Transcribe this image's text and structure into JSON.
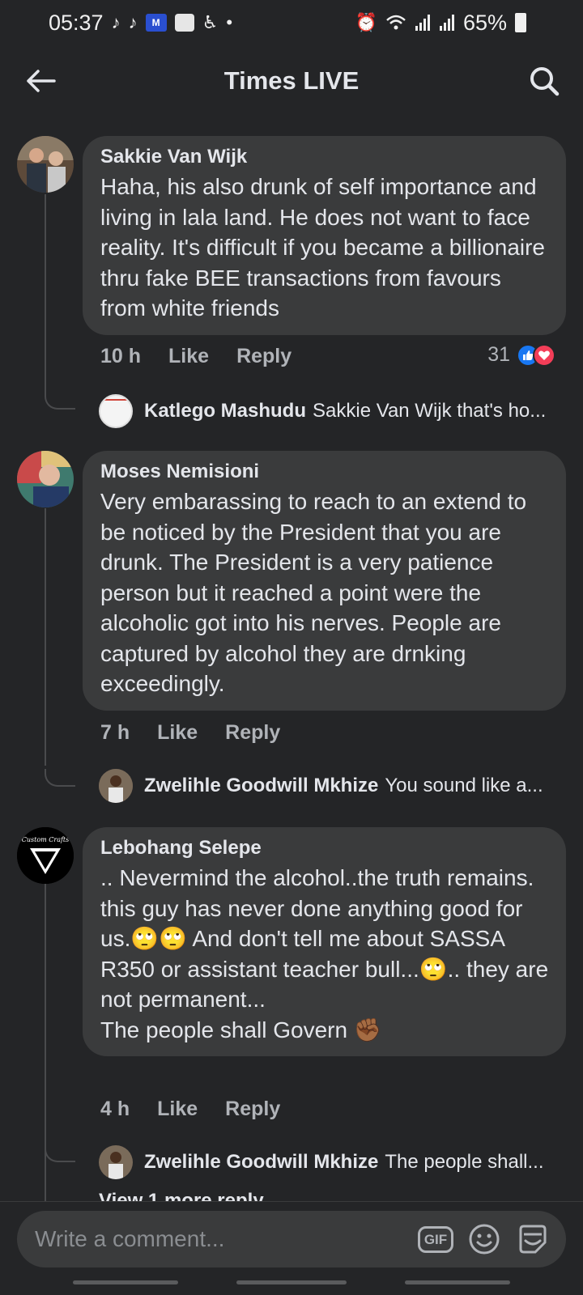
{
  "status": {
    "time": "05:37",
    "battery": "65%",
    "icons": [
      "tiktok-icon",
      "tiktok-icon",
      "movies-icon",
      "gallery-icon",
      "accessibility-icon",
      "dot-icon",
      "alarm-icon",
      "wifi-icon",
      "signal-icon",
      "signal-icon",
      "battery-icon"
    ],
    "badge_text": "M"
  },
  "header": {
    "title": "Times LIVE",
    "back_icon": "arrow-left-icon",
    "search_icon": "search-icon"
  },
  "comments": [
    {
      "author": "Sakkie Van Wijk",
      "text": "Haha, his also drunk of self importance and living in lala land. He does not want to face reality. It's difficult if you became a billionaire thru fake BEE transactions from favours from white friends",
      "time": "10 h",
      "like": "Like",
      "reply": "Reply",
      "reaction_count": "31",
      "reactions": [
        "like-reaction-icon",
        "love-reaction-icon"
      ],
      "reply_preview": {
        "author": "Katlego Mashudu",
        "text": "Sakkie Van Wijk  that's ho..."
      }
    },
    {
      "author": "Moses Nemisioni",
      "text": "Very embarassing to reach to an extend to be noticed by the President that you are drunk. The President is a very patience person but it reached a point were the alcoholic got into his nerves. People are captured by alcohol they are drnking exceedingly.",
      "time": "7 h",
      "like": "Like",
      "reply": "Reply",
      "reply_preview": {
        "author": "Zwelihle Goodwill Mkhize",
        "text": "You sound like a..."
      }
    },
    {
      "author": "Lebohang Selepe",
      "text_lines": [
        ".. Nevermind the alcohol..the truth remains. this guy has never done anything good for us.🙄🙄 And don't tell me about SASSA R350 or assistant teacher bull...🙄.. they are not permanent...",
        "The people shall Govern ✊🏾"
      ],
      "time": "4 h",
      "like": "Like",
      "reply": "Reply",
      "avatar_text": "Custom Crafts",
      "reply_preview": {
        "author": "Zwelihle Goodwill Mkhize",
        "text": "The people shall..."
      },
      "view_more": "View 1 more reply"
    }
  ],
  "composer": {
    "placeholder": "Write a comment...",
    "gif_label": "GIF",
    "icons": [
      "gif-icon",
      "emoji-icon",
      "sticker-icon"
    ]
  },
  "colors": {
    "background": "#242527",
    "bubble": "#3a3b3c",
    "text": "#e4e6eb",
    "secondary_text": "#b0b3b8",
    "like_blue": "#1877f2",
    "love_red": "#f33e58"
  }
}
